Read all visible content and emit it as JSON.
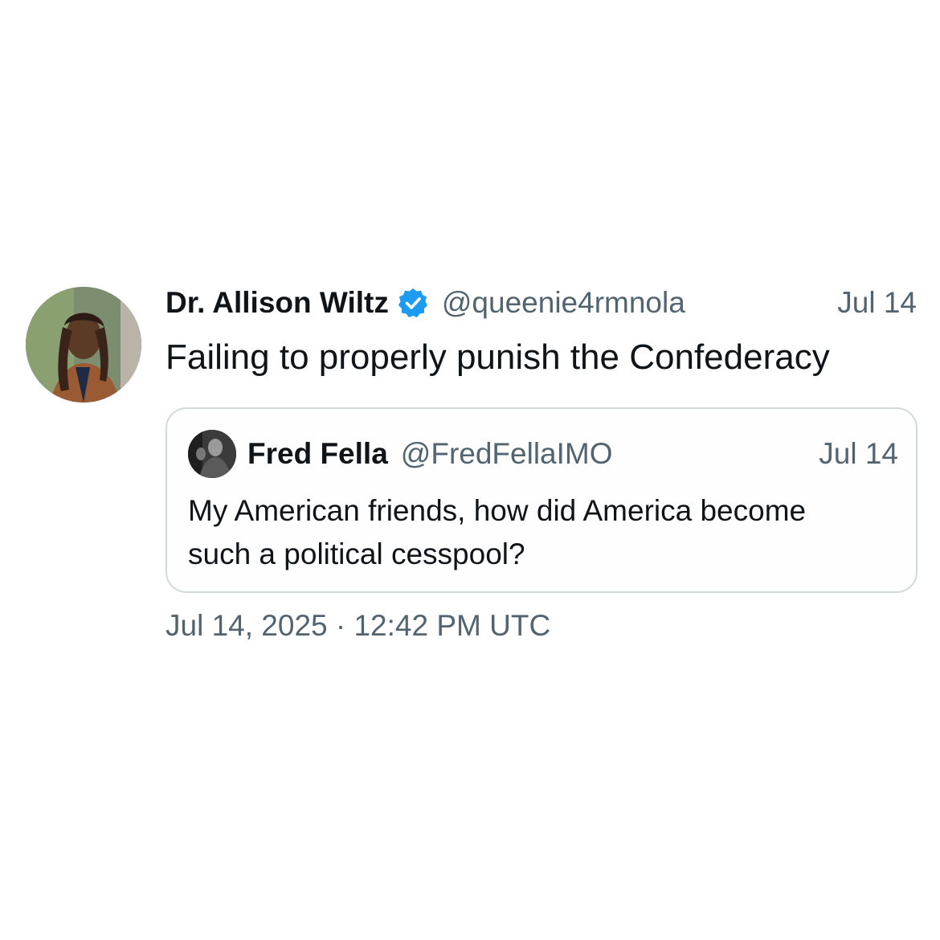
{
  "tweet": {
    "author_name": "Dr. Allison Wiltz",
    "handle": "@queenie4rmnola",
    "date": "Jul 14",
    "text": "Failing to properly punish the Confederacy",
    "verified_icon": "verified-badge-icon",
    "verified_color": "#1d9bf0",
    "timestamp": "Jul 14, 2025 · 12:42 PM UTC"
  },
  "quote": {
    "author_name": "Fred Fella",
    "handle": "@FredFellaIMO",
    "date": "Jul 14",
    "text": "My American friends, how did America become such a political cesspool?"
  }
}
